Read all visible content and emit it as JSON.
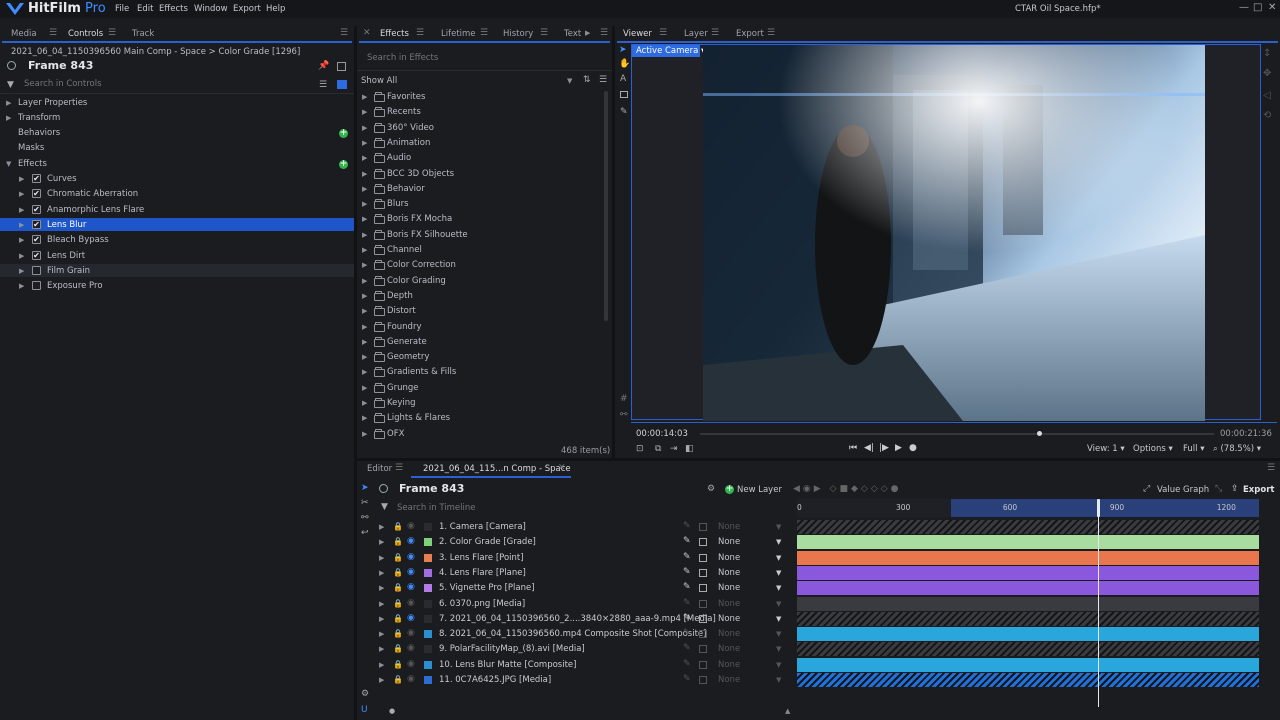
{
  "app": {
    "name_main": "HitFilm",
    "name_pro": "Pro",
    "document_title": "CTAR Oil Space.hfp*"
  },
  "menu": [
    "File",
    "Edit",
    "Effects",
    "Window",
    "Export",
    "Help"
  ],
  "window_controls": {
    "minimize": "—",
    "maximize": "□",
    "close": "✕"
  },
  "left_panel": {
    "tabs": [
      "Media",
      "Controls",
      "Track"
    ],
    "breadcrumb": "2021_06_04_1150396560 Main Comp - Space > Color Grade [1296]",
    "frame": "Frame 843",
    "search_placeholder": "Search in Controls",
    "tree": [
      {
        "label": "Layer Properties",
        "expandable": true
      },
      {
        "label": "Transform",
        "expandable": true
      },
      {
        "label": "Behaviors",
        "expandable": false,
        "add": true
      },
      {
        "label": "Masks",
        "expandable": false
      },
      {
        "label": "Effects",
        "expandable": true,
        "expanded": true,
        "add": true
      }
    ],
    "effects": [
      {
        "label": "Curves",
        "checked": true
      },
      {
        "label": "Chromatic Aberration",
        "checked": true
      },
      {
        "label": "Anamorphic Lens Flare",
        "checked": true
      },
      {
        "label": "Lens Blur",
        "checked": true,
        "selected": true
      },
      {
        "label": "Bleach Bypass",
        "checked": true
      },
      {
        "label": "Lens Dirt",
        "checked": true
      },
      {
        "label": "Film Grain",
        "checked": false,
        "hover": true
      },
      {
        "label": "Exposure Pro",
        "checked": false
      }
    ]
  },
  "effects_panel": {
    "tabs": [
      "Effects",
      "Lifetime",
      "History",
      "Text"
    ],
    "search_placeholder": "Search in Effects",
    "filter": "Show All",
    "folders": [
      "Favorites",
      "Recents",
      "360° Video",
      "Animation",
      "Audio",
      "BCC 3D Objects",
      "Behavior",
      "Blurs",
      "Boris FX Mocha",
      "Boris FX Silhouette",
      "Channel",
      "Color Correction",
      "Color Grading",
      "Depth",
      "Distort",
      "Foundry",
      "Generate",
      "Geometry",
      "Gradients & Fills",
      "Grunge",
      "Keying",
      "Lights & Flares",
      "OFX"
    ],
    "count": "468 item(s)"
  },
  "viewer": {
    "tabs": [
      "Viewer",
      "Layer",
      "Export"
    ],
    "camera": "Active Camera",
    "current_time": "00:00:14:03",
    "end_time": "00:00:21:36",
    "playhead_fraction": 0.66,
    "view": "View: 1",
    "options": "Options",
    "quality": "Full",
    "zoom": "(78.5%)"
  },
  "editor": {
    "tabs": [
      "Editor",
      "2021_06_04_115...n Comp - Space"
    ],
    "frame": "Frame 843",
    "new_layer": "New Layer",
    "value_graph": "Value Graph",
    "export": "Export",
    "search_placeholder": "Search in Timeline",
    "ruler": [
      "0",
      "300",
      "600",
      "900",
      "1200"
    ],
    "playhead_frame": 843,
    "total_frames": 1296,
    "layers": [
      {
        "name": "1. Camera [Camera]",
        "color": "",
        "blend": "None",
        "track": "#3a3b40",
        "hatched": true,
        "vis": false
      },
      {
        "name": "2. Color Grade [Grade]",
        "color": "#7fd07a",
        "blend": "None",
        "track": "#a9dda0",
        "vis": true
      },
      {
        "name": "3. Lens Flare [Point]",
        "color": "#e97d52",
        "blend": "None",
        "track": "#e9764c",
        "vis": true
      },
      {
        "name": "4. Lens Flare [Plane]",
        "color": "#a06ee0",
        "blend": "None",
        "track": "#8a58dc",
        "vis": true
      },
      {
        "name": "5. Vignette Pro [Plane]",
        "color": "#b37ae8",
        "blend": "None",
        "track": "#8a58dc",
        "vis": true
      },
      {
        "name": "6. 0370.png [Media]",
        "color": "",
        "blend": "None",
        "track": "#3a3b40",
        "vis": false
      },
      {
        "name": "7. 2021_06_04_1150396560_2....3840×2880_aaa-9.mp4 [Media]",
        "color": "",
        "blend": "None",
        "track": "#3a3b40",
        "hatched": true,
        "vis": true
      },
      {
        "name": "8. 2021_06_04_1150396560.mp4 Composite Shot [Composite]",
        "color": "#2a8fd0",
        "blend": "None",
        "track": "#29a7dc",
        "vis": false
      },
      {
        "name": "9. PolarFacilityMap_(8).avi [Media]",
        "color": "",
        "blend": "None",
        "track": "#3a3b40",
        "hatched": true,
        "vis": false
      },
      {
        "name": "10. Lens Blur Matte [Composite]",
        "color": "#2a8fd0",
        "blend": "None",
        "track": "#29a7dc",
        "vis": false
      },
      {
        "name": "11. 0C7A6425.JPG [Media]",
        "color": "#2a6fd0",
        "blend": "None",
        "track": "#2070d8",
        "hatched": true,
        "vis": false
      }
    ]
  }
}
